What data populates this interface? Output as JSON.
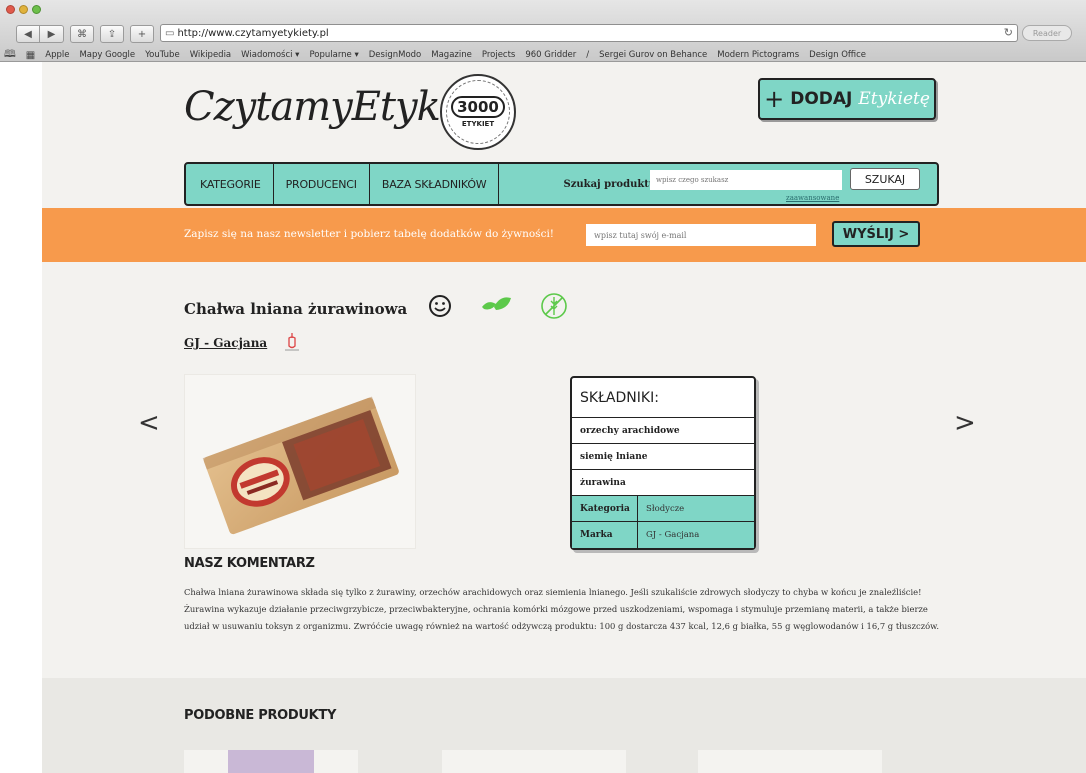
{
  "browser": {
    "url": "http://www.czytamyetykiety.pl",
    "reader_label": "Reader",
    "bookmarks": [
      "Apple",
      "Mapy Google",
      "YouTube",
      "Wikipedia",
      "Wiadomości ▾",
      "Popularne ▾",
      "DesignModo",
      "Magazine",
      "Projects",
      "960 Gridder",
      "/",
      "Sergei Gurov on Behance",
      "Modern Pictograms",
      "Design Office"
    ]
  },
  "header": {
    "logo_text": "CzytamyEtykiety",
    "seal_number": "3000",
    "seal_sub": "ETYKIET",
    "add_button": {
      "plus": "+",
      "label": "DODAJ",
      "script": "Etykietę"
    }
  },
  "nav": {
    "items": [
      "KATEGORIE",
      "PRODUCENCI",
      "BAZA SKŁADNIKÓW"
    ],
    "search_label": "Szukaj produktu:",
    "search_placeholder": "wpisz czego szukasz",
    "search_button": "SZUKAJ",
    "advanced_link": "zaawansowane"
  },
  "newsletter": {
    "text": "Zapisz się na nasz newsletter i pobierz tabelę dodatków do żywności!",
    "placeholder": "wpisz tutaj swój e-mail",
    "button": "WYŚLIJ >"
  },
  "product": {
    "title": "Chałwa lniana żurawinowa",
    "producer": "GJ - Gacjana",
    "prev_arrow": "<",
    "next_arrow": ">",
    "ingredients_title": "SKŁADNIKI:",
    "ingredients": [
      "orzechy arachidowe",
      "siemię lniane",
      "żurawina"
    ],
    "meta": [
      {
        "key": "Kategoria",
        "value": "Słodycze"
      },
      {
        "key": "Marka",
        "value": "GJ - Gacjana"
      }
    ]
  },
  "comment": {
    "heading": "NASZ KOMENTARZ",
    "body": "Chałwa lniana żurawinowa składa się tylko z żurawiny, orzechów arachidowych oraz siemienia lnianego. Jeśli szukaliście zdrowych słodyczy to chyba w końcu je znaleźliście! Żurawina wykazuje działanie przeciwgrzybicze, przeciwbakteryjne, ochrania komórki mózgowe przed uszkodzeniami, wspomaga i stymuluje przemianę materii, a także bierze udział w usuwaniu toksyn z organizmu. Zwróćcie uwagę również na wartość odżywczą produktu: 100 g dostarcza 437 kcal, 12,6 g białka, 55 g węglowodanów i 16,7 g tłuszczów."
  },
  "similar": {
    "heading": "PODOBNE PRODUKTY"
  },
  "colors": {
    "accent": "#7fd6c6",
    "newsletter": "#f79a4c",
    "leaf": "#5cc94a",
    "page_bg": "#f3f2ef"
  }
}
